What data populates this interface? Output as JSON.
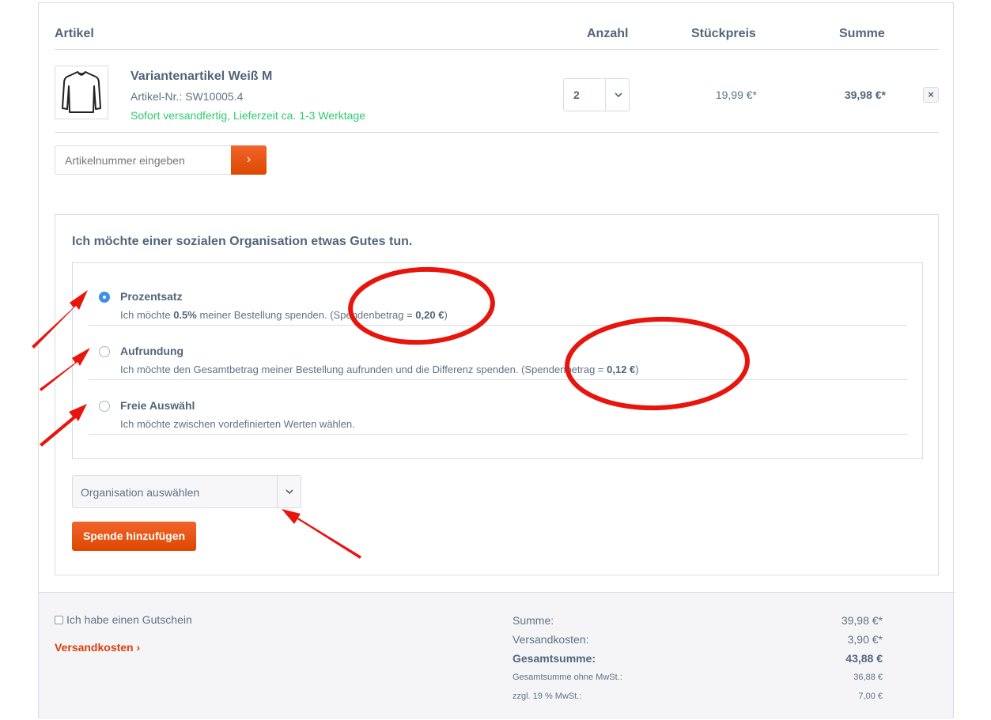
{
  "header": {
    "col_article": "Artikel",
    "col_quantity": "Anzahl",
    "col_unit_price": "Stückpreis",
    "col_sum": "Summe"
  },
  "item": {
    "image_icon": "longsleeve-shirt-icon",
    "name": "Variantenartikel Weiß M",
    "article_number": "Artikel-Nr.: SW10005.4",
    "delivery": "Sofort versandfertig, Lieferzeit ca. 1-3 Werktage",
    "quantity": "2",
    "unit_price": "19,99 €*",
    "total": "39,98 €*",
    "remove_icon": "×"
  },
  "add_article": {
    "placeholder": "Artikelnummer eingeben",
    "button_icon": "›"
  },
  "donation": {
    "title": "Ich möchte einer sozialen Organisation etwas Gutes tun.",
    "options": [
      {
        "title": "Prozentsatz",
        "text_before": "Ich möchte ",
        "percent": "0.5%",
        "text_after": " meiner Bestellung spenden. (Spendenbetrag = ",
        "amount": "0,20 €",
        "close": ")",
        "selected": true
      },
      {
        "title": "Aufrundung",
        "text_before": "Ich möchte den Gesamtbetrag meiner Bestellung aufrunden und die Differenz spenden. (Spendenbetrag = ",
        "amount": "0,12 €",
        "close": ")",
        "selected": false
      },
      {
        "title": "Freie Auswähl",
        "text": "Ich möchte zwischen vordefinierten Werten wählen.",
        "selected": false
      }
    ],
    "org_select_label": "Organisation auswählen",
    "add_button": "Spende hinzufügen"
  },
  "footer": {
    "voucher_label": "Ich habe einen Gutschein",
    "shipping_link": "Versandkosten ›",
    "summary": [
      {
        "label": "Summe:",
        "value": "39,98 €*"
      },
      {
        "label": "Versandkosten:",
        "value": "3,90 €*"
      },
      {
        "label": "Gesamtsumme:",
        "value": "43,88 €"
      },
      {
        "label": "Gesamtsumme ohne MwSt.:",
        "value": "36,88 €"
      },
      {
        "label": "zzgl. 19 % MwSt.:",
        "value": "7,00 €"
      }
    ]
  },
  "colors": {
    "accent": "#dd4800",
    "annotation_red": "#e8150d",
    "success_green": "#2ecc71",
    "radio_blue": "#3f8fe6"
  }
}
